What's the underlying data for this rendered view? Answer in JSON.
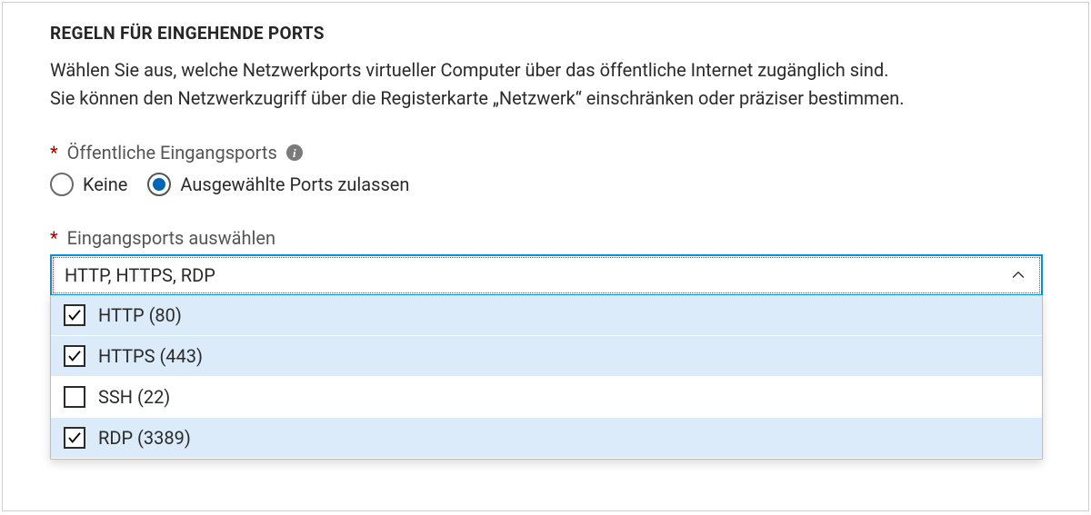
{
  "section": {
    "title": "REGELN FÜR EINGEHENDE PORTS",
    "description_line1": "Wählen Sie aus, welche Netzwerkports virtueller Computer über das öffentliche Internet zugänglich sind.",
    "description_line2": "Sie können den Netzwerkzugriff über die Registerkarte „Netzwerk“ einschränken oder präziser bestimmen."
  },
  "public_ports": {
    "label": "Öffentliche Eingangsports",
    "required_marker": "*",
    "info_tooltip": "i",
    "options": {
      "none": "Keine",
      "selected": "Ausgewählte Ports zulassen"
    },
    "value": "selected"
  },
  "select_ports": {
    "label": "Eingangsports auswählen",
    "required_marker": "*",
    "summary": "HTTP, HTTPS, RDP",
    "expanded": true,
    "options": [
      {
        "label": "HTTP (80)",
        "checked": true
      },
      {
        "label": "HTTPS (443)",
        "checked": true
      },
      {
        "label": "SSH (22)",
        "checked": false
      },
      {
        "label": "RDP (3389)",
        "checked": true
      }
    ]
  }
}
